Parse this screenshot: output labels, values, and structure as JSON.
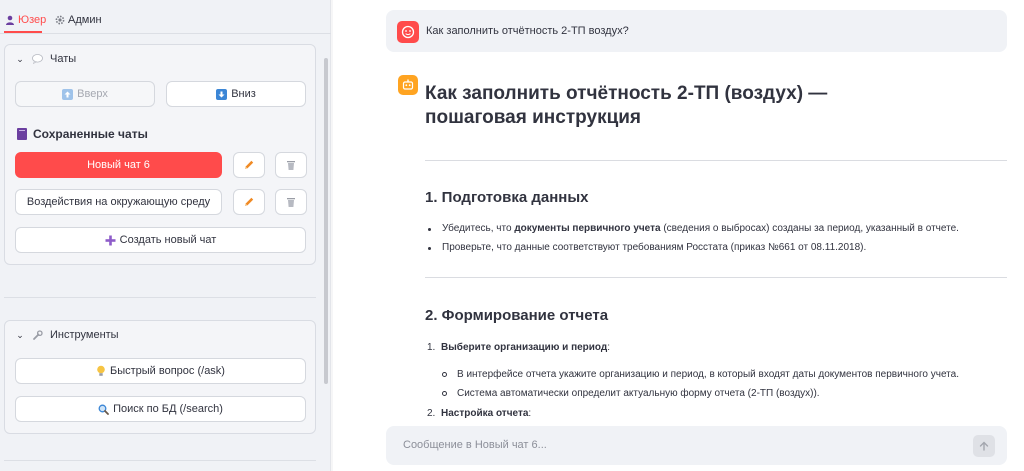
{
  "sidebar": {
    "tabs": [
      {
        "label": "Юзер",
        "icon": "user-icon"
      },
      {
        "label": "Админ",
        "icon": "gear-icon"
      }
    ],
    "chats_panel": {
      "title": "Чаты",
      "icon": "speech-bubble-icon",
      "up_button": "Вверх",
      "down_button": "Вниз",
      "saved_title": "Сохраненные чаты",
      "chats": [
        {
          "label": "Новый чат 6",
          "active": true
        },
        {
          "label": "Воздействия на окружающую среду",
          "active": false
        }
      ],
      "create_button": "Создать новый чат"
    },
    "tools_panel": {
      "title": "Инструменты",
      "icon": "wrench-icon",
      "ask_button": "Быстрый вопрос (/ask)",
      "search_button": "Поиск по БД (/search)"
    }
  },
  "main": {
    "user_message": "Как заполнить отчётность 2-ТП воздух?",
    "answer": {
      "title": "Как заполнить отчётность 2-ТП (воздух) — пошаговая инструкция",
      "section1": {
        "heading": "1. Подготовка данных",
        "item1_pre": "Убедитесь, что ",
        "item1_bold": "документы первичного учета",
        "item1_post": " (сведения о выбросах) созданы за период, указанный в отчете.",
        "item2": "Проверьте, что данные соответствуют требованиям Росстата (приказ №661 от 08.11.2018)."
      },
      "section2": {
        "heading": "2. Формирование отчета",
        "step1_num": "1.",
        "step1_bold": "Выберите организацию и период",
        "step1_colon": ":",
        "sub1": "В интерфейсе отчета укажите организацию и период, в который входят даты документов первичного учета.",
        "sub2": "Система автоматически определит актуальную форму отчета (2-ТП (воздух)).",
        "step2_num": "2.",
        "step2_bold": "Настройка отчета",
        "step2_colon": ":"
      }
    },
    "input_placeholder": "Сообщение в Новый чат 6..."
  },
  "colors": {
    "accent": "#ff4b4b",
    "bot_avatar": "#ffa421"
  }
}
